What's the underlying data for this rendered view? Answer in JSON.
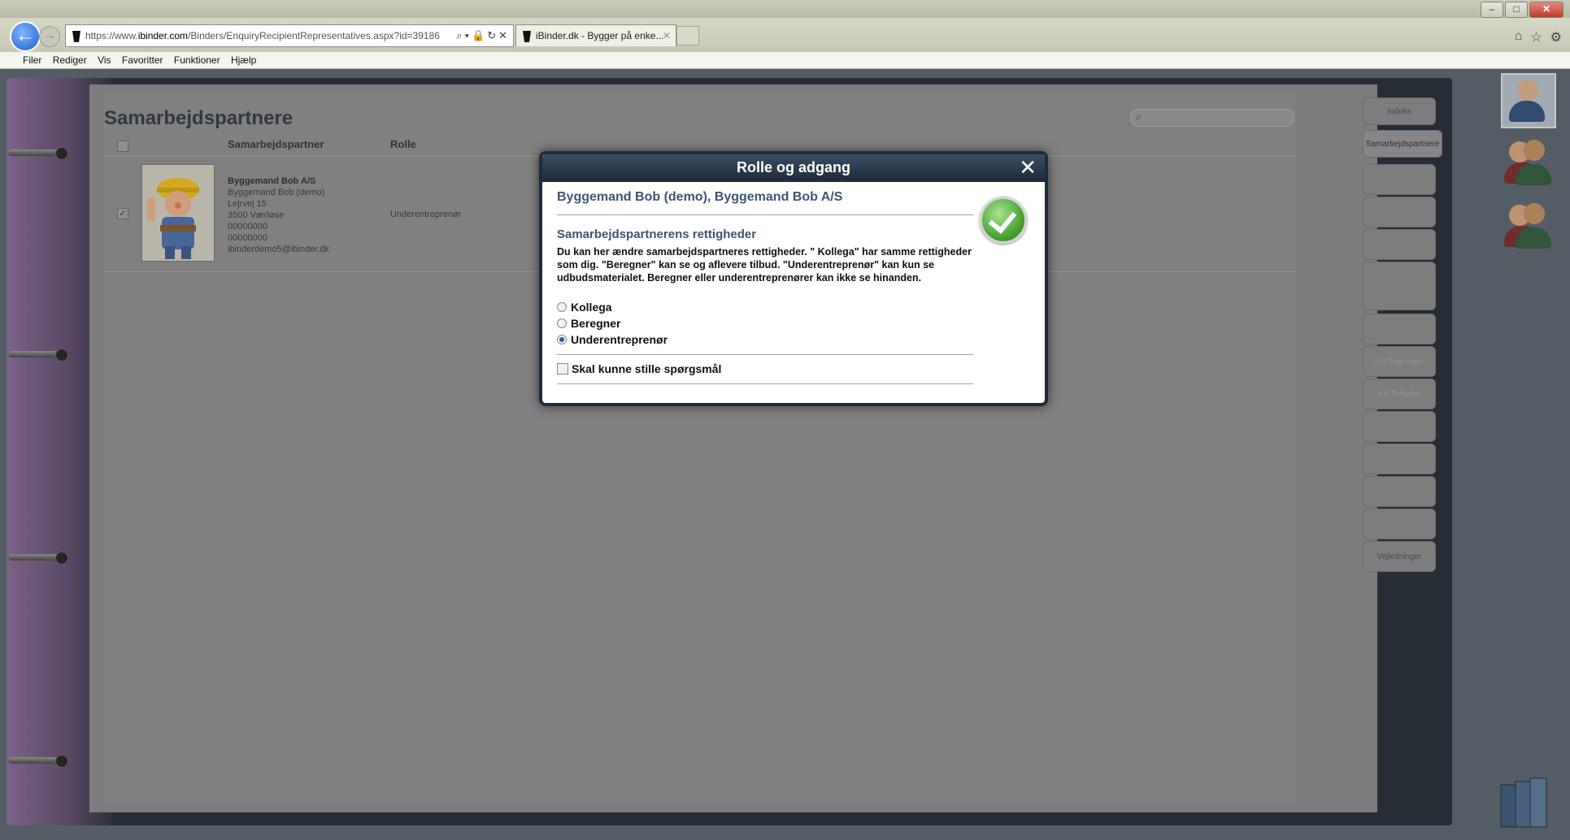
{
  "browser": {
    "url_prefix": "https://www.",
    "url_domain": "ibinder.com",
    "url_path": "/Binders/EnquiryRecipientRepresentatives.aspx?id=39186",
    "tab_title": "iBinder.dk - Bygger på enke...",
    "menu": [
      "Filer",
      "Rediger",
      "Vis",
      "Favoritter",
      "Funktioner",
      "Hjælp"
    ]
  },
  "page": {
    "title": "Samarbejdspartnere",
    "table": {
      "headers": [
        "Samarbejdspartner",
        "Rolle"
      ],
      "rows": [
        {
          "company": "Byggemand Bob A/S",
          "contact": "Byggemand Bob (demo)",
          "street": "Lejrvej 15",
          "city": "3500  Værløse",
          "phone1": "00000000",
          "phone2": "00000000",
          "email": "ibinderdemo5@ibinder.dk",
          "role": "Underentreprenør",
          "checked": true
        }
      ]
    }
  },
  "sidetabs": {
    "index": "Indeks",
    "partners": "Samarbejdspartnere",
    "tegninger": "6.0 Tegninger",
    "tidsplan": "8.0 Tidsplan",
    "vejledninger": "Vejledninger"
  },
  "dialog": {
    "title": "Rolle og adgang",
    "partner": "Byggemand Bob (demo), Byggemand Bob A/S",
    "subtitle": "Samarbejdspartnerens rettigheder",
    "description": "Du kan her ændre samarbejdspartneres rettigheder. \" Kollega\" har samme rettigheder som dig. \"Beregner\" kan se og aflevere tilbud. \"Underentreprenør\" kan kun se udbudsmaterialet. Beregner eller underentreprenører kan ikke se hinanden.",
    "options": [
      "Kollega",
      "Beregner",
      "Underentreprenør"
    ],
    "selected": "Underentreprenør",
    "question_label": "Skal kunne stille spørgsmål",
    "question_checked": false
  }
}
